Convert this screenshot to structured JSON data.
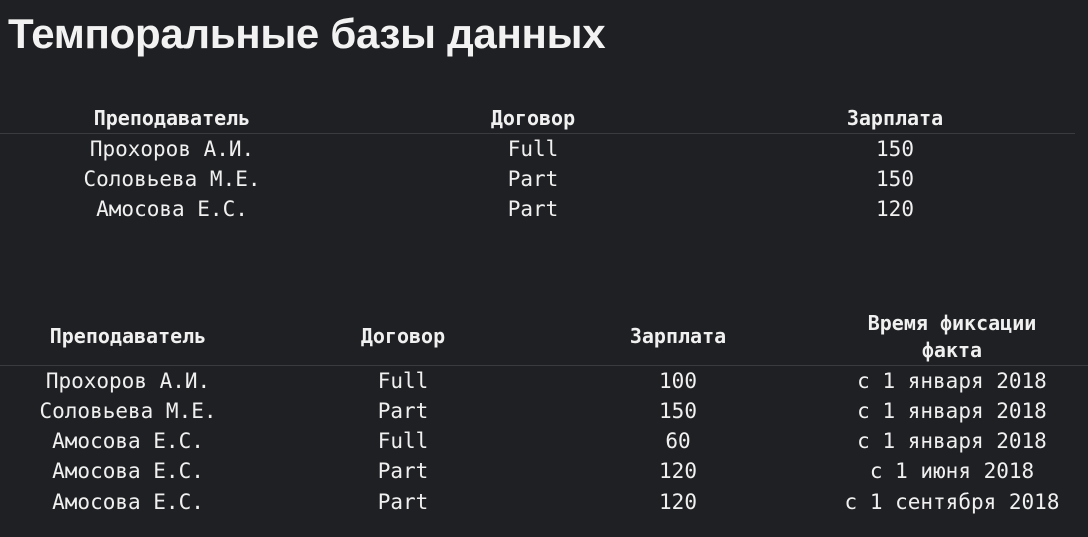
{
  "title": "Темпоральные базы данных",
  "table1": {
    "headers": [
      "Преподаватель",
      "Договор",
      "Зарплата"
    ],
    "rows": [
      [
        "Прохоров А.И.",
        "Full",
        "150"
      ],
      [
        "Соловьева М.Е.",
        "Part",
        "150"
      ],
      [
        "Амосова Е.С.",
        "Part",
        "120"
      ]
    ]
  },
  "table2": {
    "headers": [
      "Преподаватель",
      "Договор",
      "Зарплата",
      "Время фиксации",
      "факта"
    ],
    "rows": [
      [
        "Прохоров А.И.",
        "Full",
        "100",
        "с 1 января 2018"
      ],
      [
        "Соловьева М.Е.",
        "Part",
        "150",
        "с 1 января 2018"
      ],
      [
        "Амосова Е.С.",
        "Full",
        "60",
        "с 1 января 2018"
      ],
      [
        "Амосова Е.С.",
        "Part",
        "120",
        "с 1 июня 2018"
      ],
      [
        "Амосова Е.С.",
        "Part",
        "120",
        "с 1 сентября 2018"
      ]
    ]
  }
}
